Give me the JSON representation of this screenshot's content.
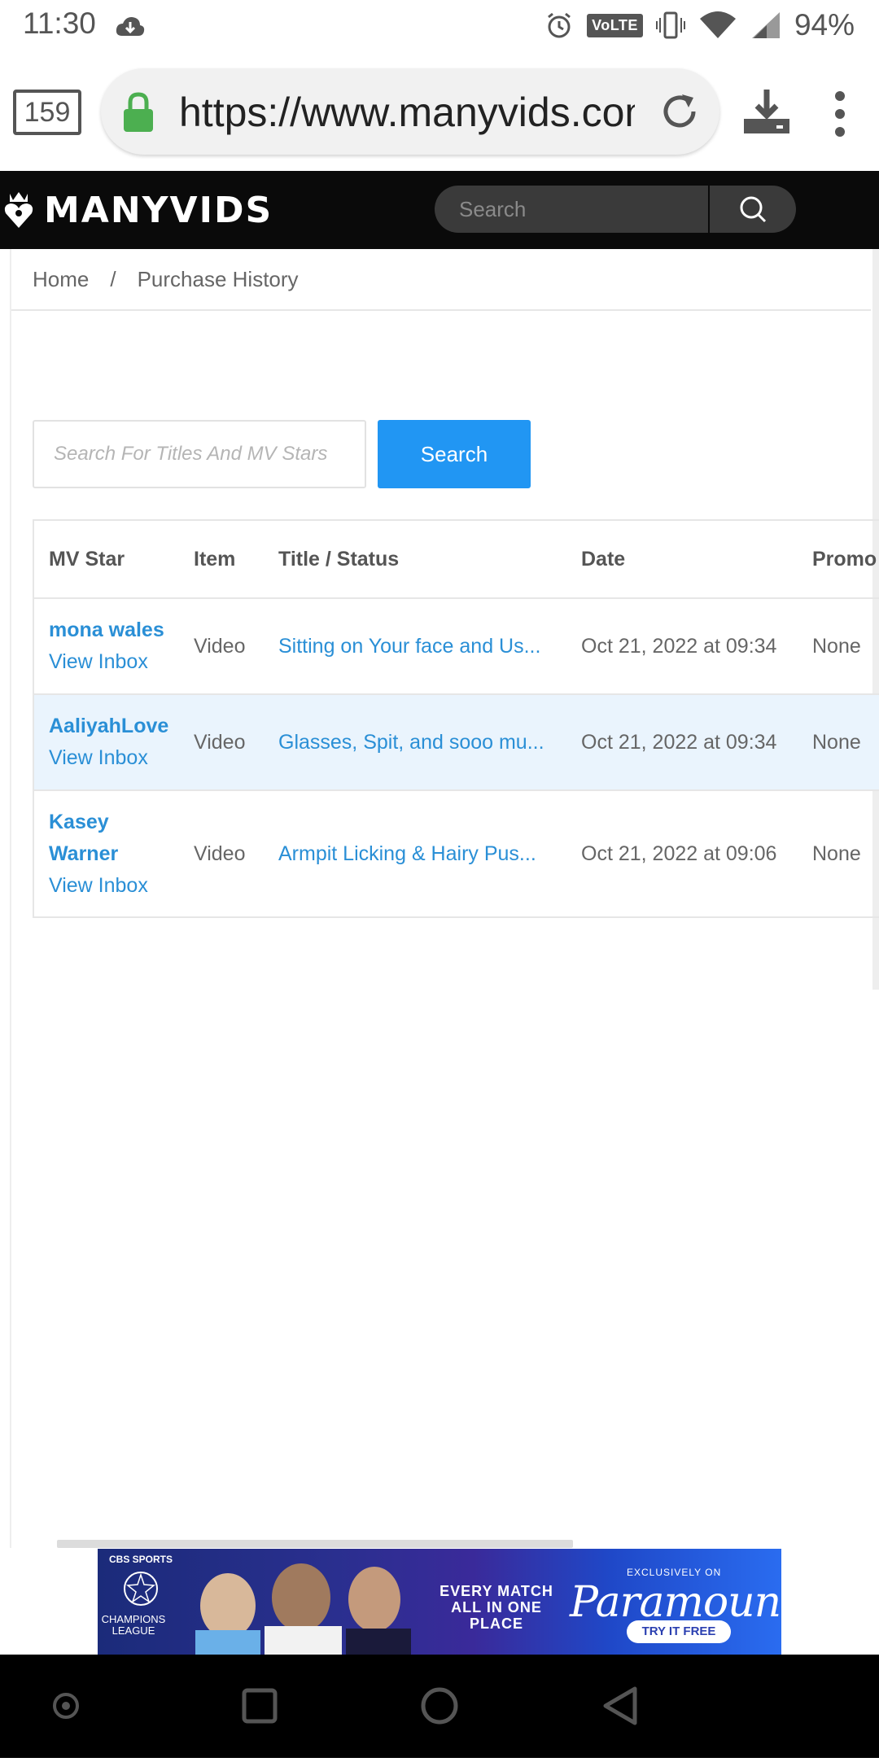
{
  "status_bar": {
    "time": "11:30",
    "volte": "VoLTE",
    "battery": "94%"
  },
  "browser": {
    "tab_count": "159",
    "url": "https://www.manyvids.com"
  },
  "site_header": {
    "logo_text": "MANYVIDS",
    "search_placeholder": "Search"
  },
  "breadcrumb": {
    "home": "Home",
    "separator": "/",
    "current": "Purchase History"
  },
  "search": {
    "placeholder": "Search For Titles And MV Stars",
    "button_label": "Search"
  },
  "table": {
    "headers": [
      "MV Star",
      "Item",
      "Title / Status",
      "Date",
      "Promo"
    ],
    "rows": [
      {
        "star": "mona wales",
        "inbox": "View Inbox",
        "item": "Video",
        "title": "Sitting on Your face and Us...",
        "date": "Oct 21, 2022 at 09:34",
        "promo": "None"
      },
      {
        "star": "AaliyahLove",
        "inbox": "View Inbox",
        "item": "Video",
        "title": "Glasses, Spit, and sooo mu...",
        "date": "Oct 21, 2022 at 09:34",
        "promo": "None"
      },
      {
        "star_line1": "Kasey",
        "star_line2": "Warner",
        "inbox": "View Inbox",
        "item": "Video",
        "title": "Armpit Licking & Hairy Pus...",
        "date": "Oct 21, 2022 at 09:06",
        "promo": "None"
      }
    ]
  },
  "ad": {
    "network": "CBS SPORTS",
    "league": "CHAMPIONS LEAGUE",
    "tagline": "EVERY MATCH ALL IN ONE PLACE",
    "exclusive": "EXCLUSIVELY ON",
    "brand": "Paramount+",
    "cta": "TRY IT FREE"
  },
  "colors": {
    "accent": "#2196f3",
    "link": "#2a8fd6",
    "header_bg": "#0a0a0a",
    "row_highlight": "#eaf4fd"
  }
}
